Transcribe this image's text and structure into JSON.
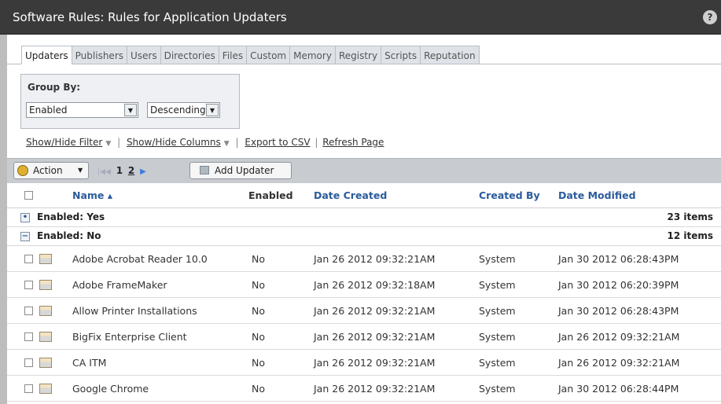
{
  "window": {
    "title": "Software Rules: Rules for Application Updaters",
    "help_label": "?"
  },
  "tabs": [
    {
      "label": "Updaters",
      "active": true
    },
    {
      "label": "Publishers"
    },
    {
      "label": "Users"
    },
    {
      "label": "Directories"
    },
    {
      "label": "Files"
    },
    {
      "label": "Custom"
    },
    {
      "label": "Memory"
    },
    {
      "label": "Registry"
    },
    {
      "label": "Scripts"
    },
    {
      "label": "Reputation"
    }
  ],
  "group_by": {
    "label": "Group By:",
    "field_value": "Enabled",
    "order_value": "Descending"
  },
  "links": {
    "filter": "Show/Hide Filter",
    "columns": "Show/Hide Columns",
    "export": "Export to CSV",
    "refresh": "Refresh Page"
  },
  "toolbar": {
    "action_label": "Action",
    "pages": [
      "1",
      "2"
    ],
    "add_label": "Add Updater"
  },
  "table": {
    "columns": {
      "name": "Name ▴",
      "enabled": "Enabled",
      "date_created": "Date Created",
      "created_by": "Created By",
      "date_modified": "Date Modified"
    },
    "groups": [
      {
        "toggle": "•",
        "label": "Enabled: Yes",
        "count": "23 items"
      },
      {
        "toggle": "−",
        "label": "Enabled: No",
        "count": "12 items"
      }
    ],
    "rows": [
      {
        "name": "Adobe Acrobat Reader 10.0",
        "enabled": "No",
        "created": "Jan 26 2012 09:32:21AM",
        "by": "System",
        "modified": "Jan 30 2012 06:28:43PM"
      },
      {
        "name": "Adobe FrameMaker",
        "enabled": "No",
        "created": "Jan 26 2012 09:32:18AM",
        "by": "System",
        "modified": "Jan 30 2012 06:20:39PM"
      },
      {
        "name": "Allow Printer Installations",
        "enabled": "No",
        "created": "Jan 26 2012 09:32:21AM",
        "by": "System",
        "modified": "Jan 30 2012 06:28:43PM"
      },
      {
        "name": "BigFix Enterprise Client",
        "enabled": "No",
        "created": "Jan 26 2012 09:32:21AM",
        "by": "System",
        "modified": "Jan 26 2012 09:32:21AM"
      },
      {
        "name": "CA ITM",
        "enabled": "No",
        "created": "Jan 26 2012 09:32:21AM",
        "by": "System",
        "modified": "Jan 26 2012 09:32:21AM"
      },
      {
        "name": "Google Chrome",
        "enabled": "No",
        "created": "Jan 26 2012 09:32:21AM",
        "by": "System",
        "modified": "Jan 30 2012 06:28:44PM"
      }
    ]
  }
}
